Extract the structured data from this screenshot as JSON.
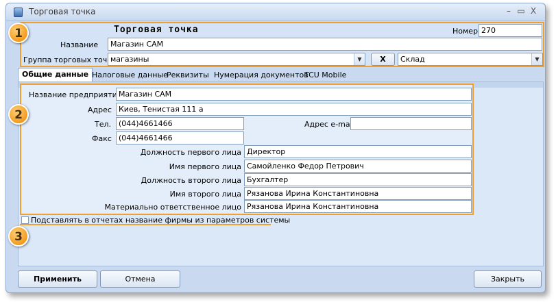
{
  "window": {
    "title": "Торговая точка",
    "minimize_glyph": "–",
    "maximize_glyph": "▭",
    "close_glyph": "X"
  },
  "header": {
    "heading": "Торговая точка",
    "number_label": "Номер",
    "number_value": "270",
    "name_label": "Название",
    "name_value": "Магазин САМ",
    "group_label": "Группа торговых точек",
    "group_value": "магазины",
    "clear_button": "X",
    "warehouse_value": "Склад"
  },
  "tabs": [
    {
      "label": "Общие данные",
      "active": true
    },
    {
      "label": "Налоговые данные"
    },
    {
      "label": "Реквизиты"
    },
    {
      "label": "Нумерация документов"
    },
    {
      "label": "TCU Mobile"
    }
  ],
  "general": {
    "company_label": "Название предприятия",
    "company_value": "Магазин САМ",
    "address_label": "Адрес",
    "address_value": "Киев, Тенистая 111 а",
    "phone_label": "Тел.",
    "phone_value": "(044)4661466",
    "email_label": "Адрес e-mail",
    "email_value": "",
    "fax_label": "Факс",
    "fax_value": "(044)4661466",
    "first_pos_label": "Должность первого лица",
    "first_pos_value": "Директор",
    "first_name_label": "Имя первого лица",
    "first_name_value": "Самойленко Федор Петрович",
    "second_pos_label": "Должность второго лица",
    "second_pos_value": "Бухгалтер",
    "second_name_label": "Имя второго лица",
    "second_name_value": "Рязанова Ирина Константиновна",
    "responsible_label": "Материально ответственное лицо",
    "responsible_value": "Рязанова Ирина Константиновна",
    "substitute_checkbox_label": "Подставлять в отчетах название фирмы из параметров системы"
  },
  "badges": [
    "1",
    "2",
    "3"
  ],
  "footer": {
    "apply": "Применить",
    "cancel": "Отмена",
    "close": "Закрыть"
  },
  "colors": {
    "highlight": "#f0a030",
    "window_bg": "#c9daf0"
  },
  "icons": {
    "window_icon": "app-window-icon",
    "dropdown": "chevron-down-icon"
  }
}
